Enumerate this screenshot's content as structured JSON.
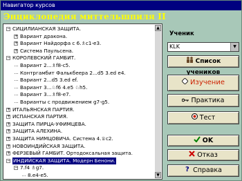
{
  "window": {
    "title": "Навигатор курсов"
  },
  "header": {
    "title": "Энциклопедия миттельшпиля II"
  },
  "tree": {
    "rows": [
      {
        "label": "СИЦИЛИАНСКАЯ ЗАЩИТА.",
        "level": 0,
        "expander": "minus"
      },
      {
        "label": "Вариант дракона.",
        "level": 1,
        "expander": "plus"
      },
      {
        "label": "Вариант Найдорфа с 6.♗c1-e3.",
        "level": 1,
        "expander": "plus"
      },
      {
        "label": "Система Паульсена.",
        "level": 1,
        "expander": "plus"
      },
      {
        "label": "КОРОЛЕВСКИЙ ГАМБИТ.",
        "level": 0,
        "expander": "minus"
      },
      {
        "label": "Вариант 2...♗f8-c5.",
        "level": 1,
        "expander": "none"
      },
      {
        "label": "Контргамбит Фалькбеера 2...d5 3.ed e4.",
        "level": 1,
        "expander": "none"
      },
      {
        "label": "Вариант 2...d5 3.ed ef.",
        "level": 1,
        "expander": "none"
      },
      {
        "label": "Вариант 3...♘f6 4.e5 ♘h5.",
        "level": 1,
        "expander": "none"
      },
      {
        "label": "Вариант 3...♗f8-e7.",
        "level": 1,
        "expander": "none"
      },
      {
        "label": "Варианты с продвижением g7-g5.",
        "level": 1,
        "expander": "none"
      },
      {
        "label": "ИТАЛЬЯНСКАЯ ПАРТИЯ.",
        "level": 0,
        "expander": "plus"
      },
      {
        "label": "ИСПАНСКАЯ ПАРТИЯ.",
        "level": 0,
        "expander": "plus"
      },
      {
        "label": "ЗАЩИТА ПИРЦА-УФИМЦЕВА.",
        "level": 0,
        "expander": "plus"
      },
      {
        "label": "ЗАЩИТА АЛЕХИНА.",
        "level": 0,
        "expander": "plus"
      },
      {
        "label": "ЗАЩИТА НИМЦОВИЧА. Система 4.♕c2.",
        "level": 0,
        "expander": "plus"
      },
      {
        "label": "НОВОИНДИЙСКАЯ ЗАЩИТА.",
        "level": 0,
        "expander": "plus"
      },
      {
        "label": "ФЕРЗЕВЫЙ ГАМБИТ. Ортодоксальная защита.",
        "level": 0,
        "expander": "plus"
      },
      {
        "label": "ИНДИЙСКАЯ ЗАЩИТА. Модерн Бенони.",
        "level": 0,
        "expander": "minus",
        "selected": true
      },
      {
        "label": "7.f4 ♗g7.",
        "level": 1,
        "expander": "minus"
      },
      {
        "label": "8.e4-e5.",
        "level": 2,
        "expander": "none"
      }
    ]
  },
  "student": {
    "label": "Ученик",
    "value": "KLK"
  },
  "buttons": {
    "students": "Список учеников",
    "study": "Изучение",
    "practice": "Практика",
    "test": "Тест",
    "ok": "OK",
    "cancel": "Отказ",
    "help": "Справка"
  },
  "icons": {
    "students": "people-icon",
    "study": "diamond-icon",
    "practice": "key-icon",
    "test": "target-icon",
    "ok": "checkmark-icon",
    "cancel": "x-icon",
    "help": "question-icon"
  },
  "colors": {
    "window_bg": "#a8c8b8",
    "title_text": "#ffff00",
    "titlebar": "#000080",
    "selection": "#000080",
    "study_text": "#cc2000"
  }
}
